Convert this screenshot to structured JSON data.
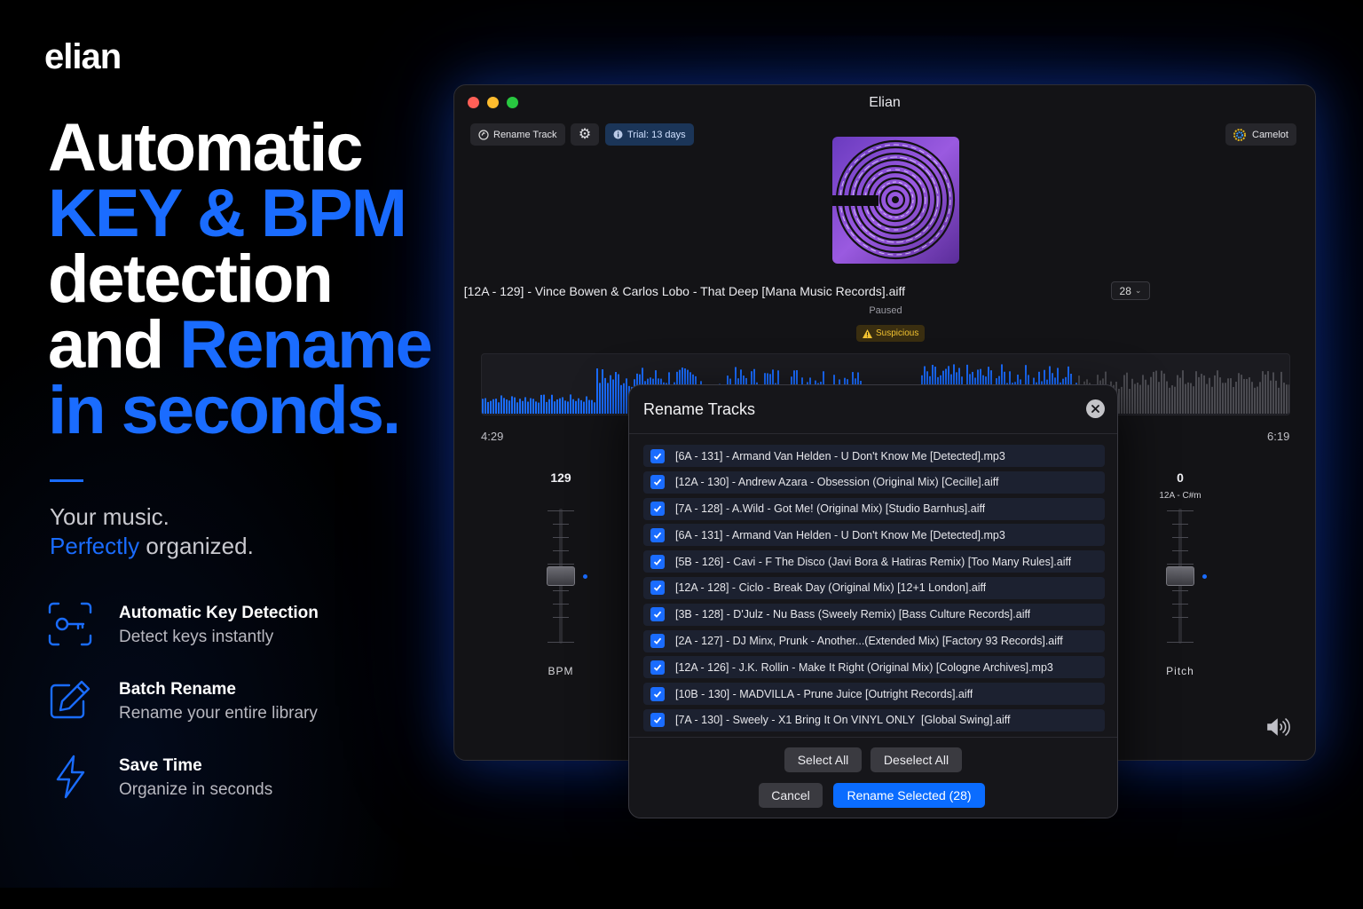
{
  "brand": "elian",
  "headline": {
    "line1": "Automatic",
    "line2": "KEY & BPM",
    "line3": "detection",
    "line4a": "and ",
    "line4b": "Rename",
    "line5": "in seconds."
  },
  "tagline": {
    "line1": "Your music.",
    "line2a": "Perfectly",
    "line2b": " organized."
  },
  "features": [
    {
      "icon": "key-scan-icon",
      "title": "Automatic Key Detection",
      "subtitle": "Detect keys instantly"
    },
    {
      "icon": "edit-pen-icon",
      "title": "Batch Rename",
      "subtitle": "Rename your entire library"
    },
    {
      "icon": "lightning-icon",
      "title": "Save Time",
      "subtitle": "Organize in seconds"
    }
  ],
  "colors": {
    "accent": "#1a6cff",
    "background": "#000000",
    "window": "#131316",
    "warning": "#f2c230"
  },
  "app": {
    "title": "Elian",
    "toolbar": {
      "rename_track": "Rename Track",
      "trial": "Trial: 13 days",
      "camelot": "Camelot"
    },
    "track": {
      "title": "[12A - 129] - Vince Bowen & Carlos Lobo - That Deep [Mana Music Records].aiff",
      "count": "28",
      "state": "Paused",
      "warning": "Suspicious"
    },
    "time": {
      "elapsed": "4:29",
      "total": "6:19"
    },
    "playback_fraction": 0.74,
    "bpm": {
      "value": "129",
      "label": "BPM"
    },
    "pitch": {
      "value": "0",
      "key": "12A - C#m",
      "label": "Pitch"
    }
  },
  "dialog": {
    "title": "Rename Tracks",
    "rows": [
      "[6A - 131] - Armand Van Helden - U Don't Know Me [Detected].mp3",
      "[12A - 130] - Andrew Azara - Obsession (Original Mix) [Cecille].aiff",
      "[7A - 128] - A.Wild - Got Me! (Original Mix) [Studio Barnhus].aiff",
      "[6A - 131] - Armand Van Helden - U Don't Know Me [Detected].mp3",
      "[5B - 126] - Cavi - F The Disco (Javi Bora & Hatiras Remix) [Too Many Rules].aiff",
      "[12A - 128] - Ciclo - Break Day (Original Mix) [12+1 London].aiff",
      "[3B - 128] - D'Julz - Nu Bass (Sweely Remix) [Bass Culture Records].aiff",
      "[2A - 127] - DJ Minx, Prunk - Another...(Extended Mix) [Factory 93 Records].aiff",
      "[12A - 126] - J.K. Rollin - Make It Right (Original Mix) [Cologne Archives].mp3",
      "[10B - 130] - MADVILLA - Prune Juice [Outright Records].aiff",
      "[7A - 130] - Sweely - X1 Bring It On VINYL ONLY  [Global Swing].aiff"
    ],
    "select_all": "Select All",
    "deselect_all": "Deselect All",
    "cancel": "Cancel",
    "rename_selected": "Rename Selected (28)"
  }
}
